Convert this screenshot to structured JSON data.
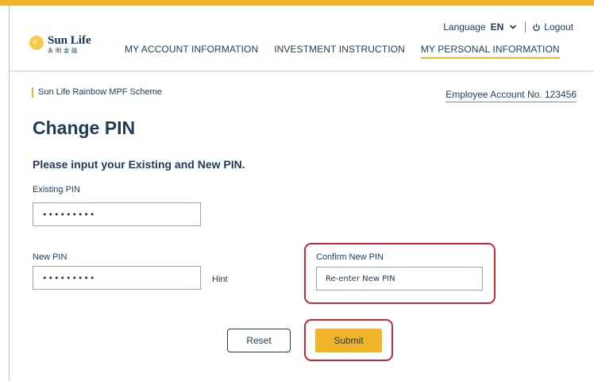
{
  "brand": {
    "name_en": "Sun Life",
    "name_cn": "永明金融",
    "accent_color": "#f0b429",
    "text_color": "#1f3b57",
    "highlight_color": "#c8263d"
  },
  "utility": {
    "language_label": "Language",
    "language_value": "EN",
    "logout_label": "Logout"
  },
  "nav": {
    "items": [
      {
        "label": "MY ACCOUNT INFORMATION"
      },
      {
        "label": "INVESTMENT INSTRUCTION"
      },
      {
        "label": "MY PERSONAL INFORMATION",
        "active": true
      }
    ]
  },
  "context": {
    "scheme": "Sun Life Rainbow MPF Scheme",
    "account": "Employee Account No. 123456"
  },
  "page": {
    "title": "Change PIN",
    "subtitle": "Please input your Existing and New PIN."
  },
  "form": {
    "existing_pin": {
      "label": "Existing PIN",
      "value": "•••••••••"
    },
    "new_pin": {
      "label": "New PIN",
      "value": "•••••••••",
      "hint": "Hint"
    },
    "confirm_pin": {
      "label": "Confirm New PIN",
      "placeholder": "Re-enter New PIN"
    }
  },
  "actions": {
    "reset_label": "Reset",
    "submit_label": "Submit"
  },
  "icons": {
    "logo": "sun-icon",
    "language_dropdown": "chevron-down-icon",
    "logout": "power-icon"
  }
}
